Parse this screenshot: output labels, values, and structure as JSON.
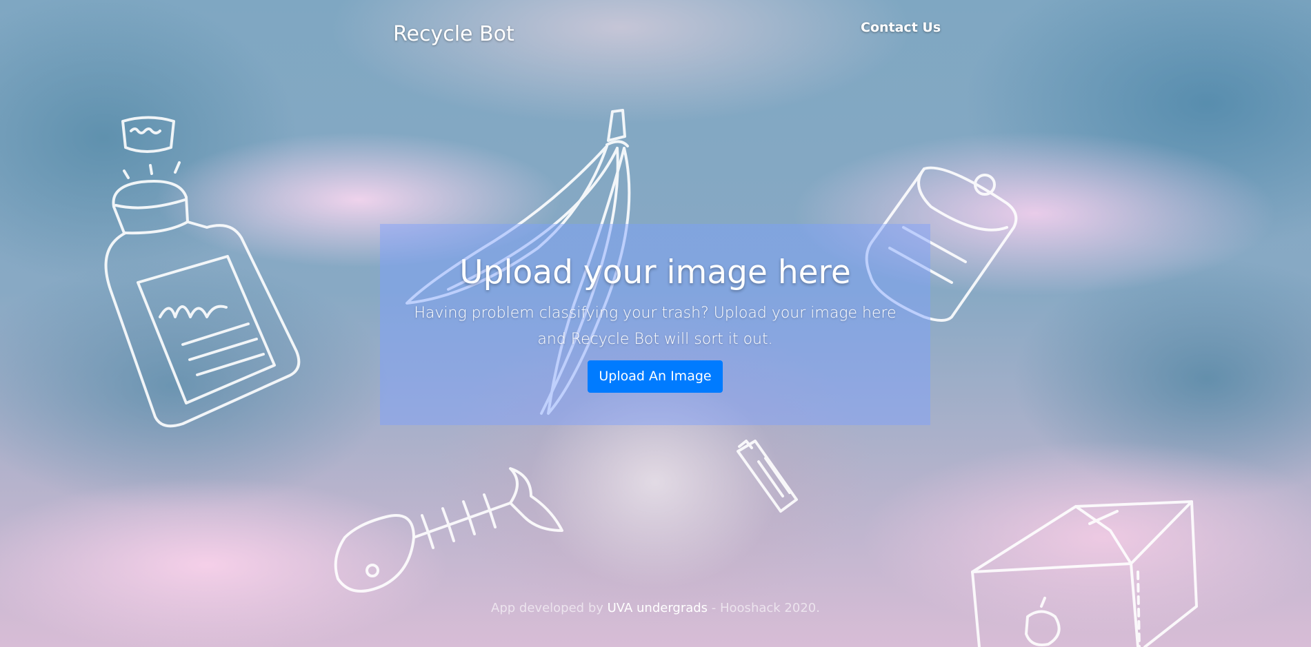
{
  "navbar": {
    "brand": "Recycle Bot",
    "contact_link": "Contact Us"
  },
  "hero": {
    "title": "Upload your image here",
    "description": "Having problem classifying your trash? Upload your image here and Recycle Bot will sort it out.",
    "upload_button": "Upload An Image",
    "background_color": "#7da0ff"
  },
  "footer": {
    "prefix": "App developed by ",
    "link_text": "UVA undergrads",
    "suffix": " - Hooshack 2020."
  },
  "colors": {
    "button": "#007bff",
    "text": "#ffffff"
  },
  "doodles": [
    "bottle-doodle",
    "banana-peel-doodle",
    "can-doodle",
    "fish-bone-doodle",
    "battery-doodle",
    "cardboard-box-doodle",
    "apple-core-doodle"
  ]
}
